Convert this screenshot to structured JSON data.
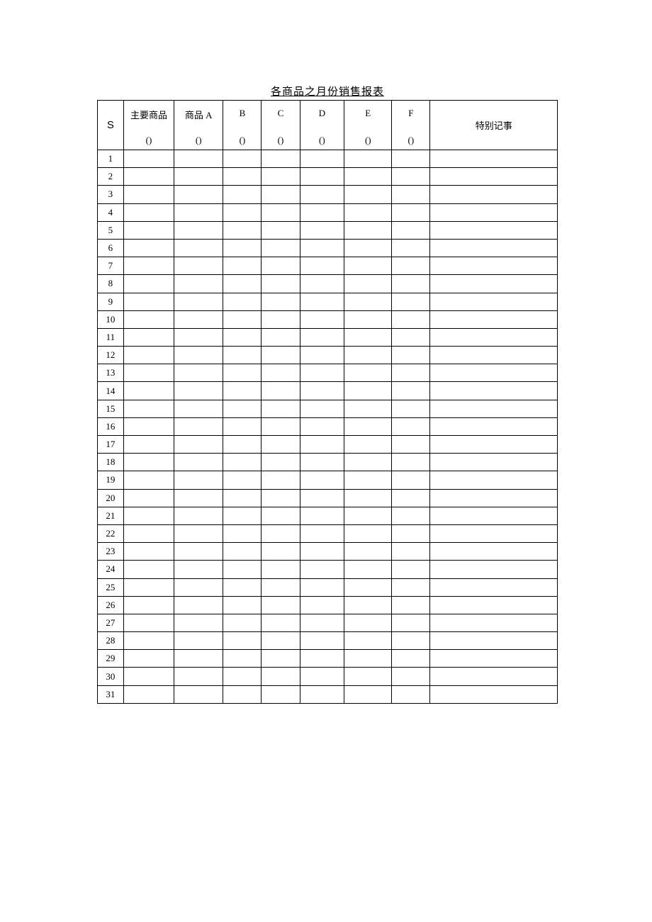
{
  "title": "各商品之月份销售报表",
  "header": {
    "s_label": "S",
    "main_product": "主要商品",
    "product_a": "商品 A",
    "product_b": "B",
    "product_c": "C",
    "product_d": "D",
    "product_e": "E",
    "product_f": "F",
    "notes": "特别记事",
    "paren": "()"
  },
  "rows": [
    {
      "n": "1"
    },
    {
      "n": "2"
    },
    {
      "n": "3"
    },
    {
      "n": "4"
    },
    {
      "n": "5"
    },
    {
      "n": "6"
    },
    {
      "n": "7"
    },
    {
      "n": "8"
    },
    {
      "n": "9"
    },
    {
      "n": "10"
    },
    {
      "n": "11"
    },
    {
      "n": "12"
    },
    {
      "n": "13"
    },
    {
      "n": "14"
    },
    {
      "n": "15"
    },
    {
      "n": "16"
    },
    {
      "n": "17"
    },
    {
      "n": "18"
    },
    {
      "n": "19"
    },
    {
      "n": "20"
    },
    {
      "n": "21"
    },
    {
      "n": "22"
    },
    {
      "n": "23"
    },
    {
      "n": "24"
    },
    {
      "n": "25"
    },
    {
      "n": "26"
    },
    {
      "n": "27"
    },
    {
      "n": "28"
    },
    {
      "n": "29"
    },
    {
      "n": "30"
    },
    {
      "n": "31"
    }
  ]
}
